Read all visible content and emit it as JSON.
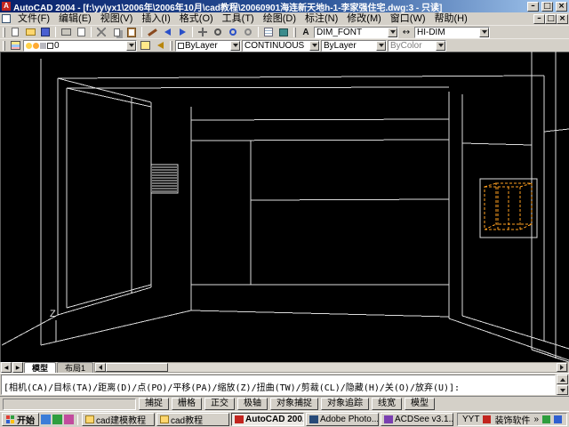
{
  "title_bar": {
    "title": "AutoCAD 2004 - [f:\\yy\\yx1\\2006年\\2006年10月\\cad教程\\20060901海连新天地h-1-李家强住宅.dwg:3 - 只读]",
    "minimize": "–",
    "restore": "□",
    "close": "×"
  },
  "menu_bar": {
    "items": [
      "文件(F)",
      "编辑(E)",
      "视图(V)",
      "插入(I)",
      "格式(O)",
      "工具(T)",
      "绘图(D)",
      "标注(N)",
      "修改(M)",
      "窗口(W)",
      "帮助(H)"
    ]
  },
  "toolbar_standard": {
    "icons": [
      "new-file",
      "open-file",
      "save",
      "print",
      "print-preview",
      "cut",
      "copy",
      "paste",
      "match-properties",
      "undo",
      "redo",
      "pan",
      "zoom-realtime",
      "zoom-window",
      "zoom-previous",
      "properties",
      "design-center",
      "text-style",
      "dim-style"
    ],
    "text_style_value": "DIM_FONT",
    "dim_style_value": "HI-DIM"
  },
  "toolbar_properties": {
    "layer_value": "0",
    "color_value": "ByLayer",
    "linetype_value": "CONTINUOUS",
    "lineweight_value": "ByLayer",
    "plot_style_value": "ByColor"
  },
  "canvas": {
    "z_axis_label": "Z",
    "background": "#000000",
    "line_color": "#dcdcdc",
    "highlight_color": "#ff9f1f"
  },
  "layout_tabs": {
    "scroll_left": "◀",
    "scroll_right": "▶",
    "model": "模型",
    "layout1": "布局1"
  },
  "command_window": {
    "prompt": "[相机(CA)/目标(TA)/距离(D)/点(PO)/平移(PA)/缩放(Z)/扭曲(TW)/剪裁(CL)/隐藏(H)/关(O)/放弃(U)]:"
  },
  "status_bar": {
    "coordinates": "",
    "buttons": [
      "捕捉",
      "栅格",
      "正交",
      "极轴",
      "对象捕捉",
      "对象追踪",
      "线宽",
      "模型"
    ]
  },
  "taskbar": {
    "start": "开始",
    "tasks": [
      {
        "label": "cad建模教程"
      },
      {
        "label": "cad教程"
      },
      {
        "label": "AutoCAD 200..."
      },
      {
        "label": "Adobe Photo..."
      },
      {
        "label": "ACDSee v3.1..."
      }
    ],
    "tray_items": [
      "YYT",
      "装饰软件",
      "»"
    ]
  }
}
